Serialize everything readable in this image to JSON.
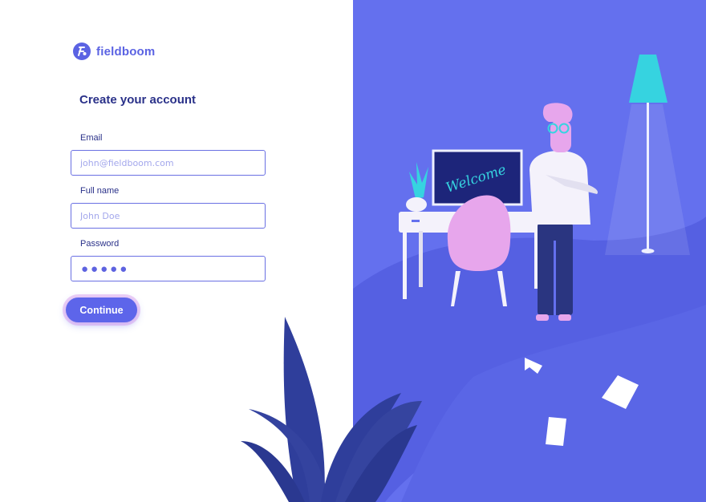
{
  "brand": {
    "name": "fieldboom",
    "logo_icon": "fieldboom-logo-icon",
    "color": "#5b63e3"
  },
  "form": {
    "heading": "Create your account",
    "email": {
      "label": "Email",
      "placeholder": "john@fieldboom.com",
      "value": ""
    },
    "full_name": {
      "label": "Full name",
      "placeholder": "John Doe",
      "value": ""
    },
    "password": {
      "label": "Password",
      "masked_display": "●●●●●"
    },
    "continue_label": "Continue"
  },
  "illustration": {
    "monitor_text": "Welcome",
    "colors": {
      "background": "#6470ee",
      "path": "#5560e2",
      "lamp_shade": "#36d3e0",
      "chair": "#e7a6ec"
    }
  },
  "colors": {
    "accent": "#5d65ea",
    "heading": "#2a3189",
    "input_border": "#6a70e3"
  }
}
